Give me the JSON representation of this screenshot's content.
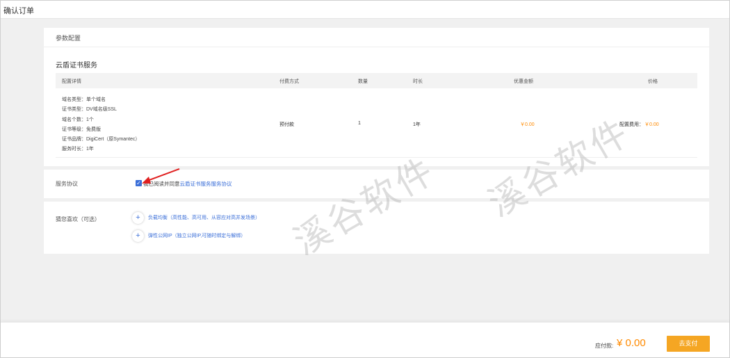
{
  "page": {
    "title": "确认订单"
  },
  "config": {
    "header": "参数配置",
    "service_title": "云盾证书服务",
    "columns": [
      "配置详情",
      "付费方式",
      "数量",
      "时长",
      "优惠金额",
      "价格"
    ],
    "row": {
      "specs": [
        "域名类型：单个域名",
        "证书类型：DV域名级SSL",
        "域名个数：1个",
        "证书等级：免费版",
        "证书品牌：DigiCert（原Symantec）",
        "服务时长：1年"
      ],
      "payment": "预付款",
      "quantity": "1",
      "duration": "1年",
      "discount": "￥0.00",
      "price_label": "配置费用：",
      "price": "￥0.00"
    }
  },
  "agreement": {
    "label": "服务协议",
    "checked_mark": "✓",
    "text": "我已阅读并同意",
    "link": "云盾证书服务服务协议"
  },
  "recommend": {
    "label": "猜您喜欢（可选）",
    "items": [
      {
        "icon": "plus-icon",
        "plus": "+",
        "text": "负载均衡（高性能、高可用、从容应对高并发场景）"
      },
      {
        "icon": "plus-icon",
        "plus": "+",
        "text": "弹性公网IP（独立公网IP,可随时绑定与解绑）"
      }
    ]
  },
  "watermark": [
    "溪谷软件",
    "溪谷软件"
  ],
  "footer": {
    "due_label": "应付款:",
    "due_amount": "¥ 0.00",
    "pay_button": "去支付"
  },
  "colors": {
    "accent": "#3b6fd8",
    "price": "#ff8a00",
    "pay_button": "#f5a623",
    "arrow": "#e02020"
  }
}
